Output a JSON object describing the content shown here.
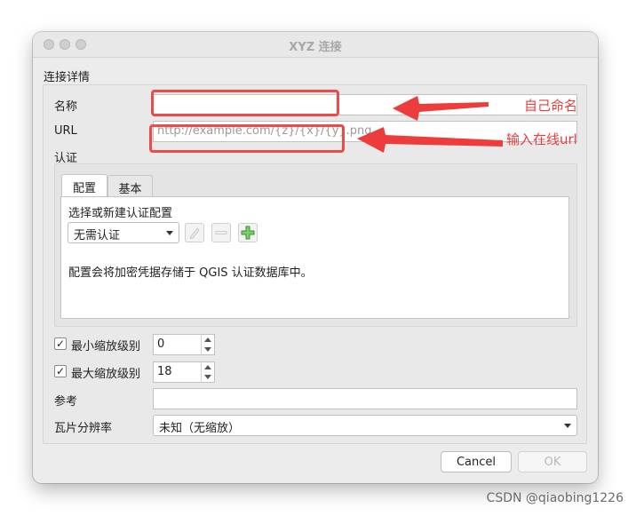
{
  "window": {
    "title": "XYZ 连接"
  },
  "connection_details": {
    "group_title": "连接详情",
    "name": {
      "label": "名称",
      "value": ""
    },
    "url": {
      "label": "URL",
      "placeholder": "http://example.com/{z}/{x}/{y}.png"
    },
    "auth_label": "认证"
  },
  "auth": {
    "tabs": [
      {
        "label": "配置",
        "active": true
      },
      {
        "label": "基本",
        "active": false
      }
    ],
    "select_label": "选择或新建认证配置",
    "selected_config": "无需认证",
    "info_text": "配置会将加密凭据存储于 QGIS 认证数据库中。",
    "icons": [
      "pencil-icon",
      "remove-icon",
      "add-icon"
    ]
  },
  "zoom": {
    "min": {
      "label": "最小缩放级别",
      "checked": true,
      "value": "0"
    },
    "max": {
      "label": "最大缩放级别",
      "checked": true,
      "value": "18"
    }
  },
  "referer": {
    "label": "参考",
    "value": ""
  },
  "tile_resolution": {
    "label": "瓦片分辨率",
    "value": "未知（无缩放）"
  },
  "buttons": {
    "cancel": "Cancel",
    "ok": "OK"
  },
  "annotations": {
    "name_hint": "自己命名",
    "url_hint": "输入在线url",
    "color": "#ee3b3b"
  },
  "watermark": "CSDN @qiaobing1226"
}
